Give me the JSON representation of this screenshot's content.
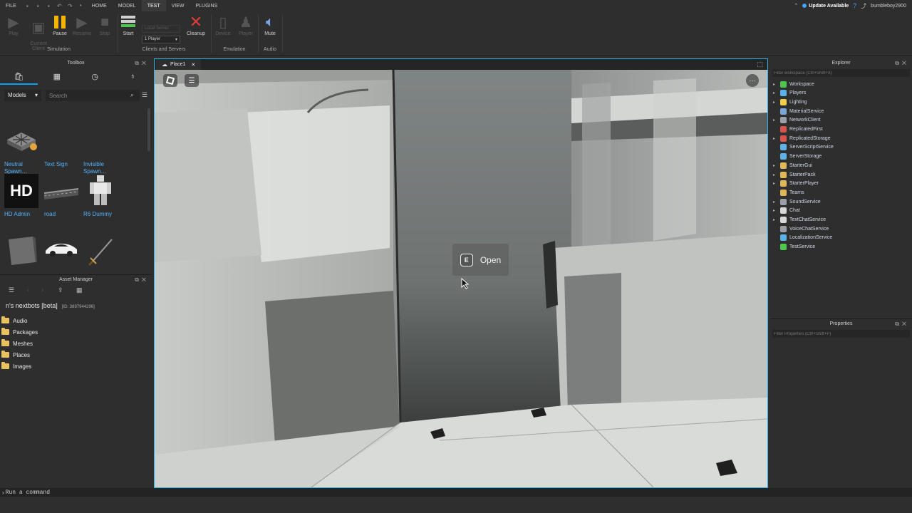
{
  "menubar": {
    "file_label": "FILE",
    "tabs": [
      "HOME",
      "MODEL",
      "TEST",
      "VIEW",
      "PLUGINS"
    ],
    "active_tab": "TEST",
    "update_label": "Update Available",
    "username": "bumbleboy2900"
  },
  "ribbon": {
    "simulation": {
      "play": "Play",
      "current_client": "Current\nClient",
      "pause": "Pause",
      "resume": "Resume",
      "stop": "Stop",
      "group_label": "Simulation"
    },
    "clients": {
      "start": "Start",
      "server_select": "Local Server",
      "player_select": "1 Player",
      "cleanup": "Cleanup",
      "group_label": "Clients and Servers"
    },
    "emulation": {
      "device": "Device",
      "player": "Player",
      "group_label": "Emulation"
    },
    "audio": {
      "mute": "Mute",
      "group_label": "Audio"
    }
  },
  "toolbox": {
    "title": "Toolbox",
    "category": "Models",
    "search_placeholder": "Search",
    "assets": [
      {
        "label": "Neutral Spawn…"
      },
      {
        "label": "Text Sign"
      },
      {
        "label": "Invisible Spawn…"
      },
      {
        "label": "HD Admin"
      },
      {
        "label": "road"
      },
      {
        "label": "R6 Dummy"
      },
      {
        "label": ""
      },
      {
        "label": ""
      },
      {
        "label": ""
      }
    ],
    "hd_text": "HD"
  },
  "asset_manager": {
    "title": "Asset Manager",
    "game_name": "n's nextbots [beta]",
    "game_id": "[ID: 3897944296]",
    "folders": [
      "Audio",
      "Packages",
      "Meshes",
      "Places",
      "Images"
    ]
  },
  "viewport": {
    "tab_label": "Place1",
    "prompt_key": "E",
    "prompt_label": "Open"
  },
  "explorer": {
    "title": "Explorer",
    "filter_placeholder": "Filter workspace (Ctrl+Shift+X)",
    "items": [
      {
        "label": "Workspace",
        "color": "#4fc44f",
        "expandable": true
      },
      {
        "label": "Players",
        "color": "#5ab2e8",
        "expandable": true
      },
      {
        "label": "Lighting",
        "color": "#f3d04b",
        "expandable": true
      },
      {
        "label": "MaterialService",
        "color": "#7ca7d9",
        "expandable": false
      },
      {
        "label": "NetworkClient",
        "color": "#9aa0a6",
        "expandable": true
      },
      {
        "label": "ReplicatedFirst",
        "color": "#d9534f",
        "expandable": false
      },
      {
        "label": "ReplicatedStorage",
        "color": "#d9534f",
        "expandable": true
      },
      {
        "label": "ServerScriptService",
        "color": "#5fb3e6",
        "expandable": false
      },
      {
        "label": "ServerStorage",
        "color": "#5fb3e6",
        "expandable": false
      },
      {
        "label": "StarterGui",
        "color": "#e0b75a",
        "expandable": true
      },
      {
        "label": "StarterPack",
        "color": "#e0b75a",
        "expandable": true
      },
      {
        "label": "StarterPlayer",
        "color": "#e0b75a",
        "expandable": true
      },
      {
        "label": "Teams",
        "color": "#e0b75a",
        "expandable": false
      },
      {
        "label": "SoundService",
        "color": "#9aa0a6",
        "expandable": true
      },
      {
        "label": "Chat",
        "color": "#d8d8d8",
        "expandable": true
      },
      {
        "label": "TextChatService",
        "color": "#d8d8d8",
        "expandable": true
      },
      {
        "label": "VoiceChatService",
        "color": "#9aa0a6",
        "expandable": false
      },
      {
        "label": "LocalizationService",
        "color": "#5ab2e8",
        "expandable": false
      },
      {
        "label": "TestService",
        "color": "#4fc44f",
        "expandable": false
      }
    ]
  },
  "properties": {
    "title": "Properties",
    "filter_placeholder": "Filter Properties (Ctrl+Shift+P)"
  },
  "command_bar": {
    "placeholder": "Run a command"
  },
  "colors": {
    "accent": "#00a2ff",
    "viewport_border": "#2fb2e6",
    "pause": "#f5b400",
    "cleanup": "#e03b3b"
  }
}
